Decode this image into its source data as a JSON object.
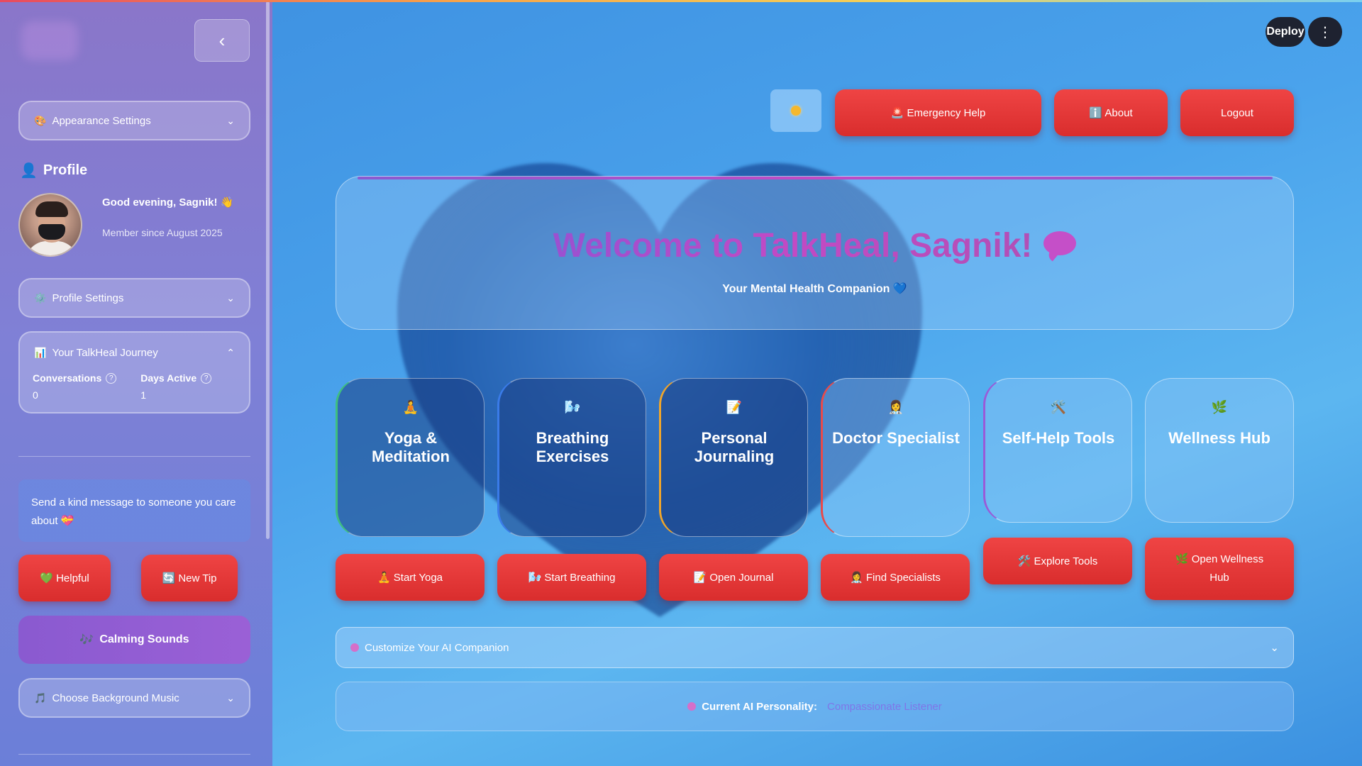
{
  "header": {
    "deploy_label": "Deploy",
    "menu_icon": "kebab-menu-icon"
  },
  "sidebar": {
    "collapse_icon": "chevron-left-icon",
    "appearance": {
      "label": "Appearance Settings",
      "icon": "palette-icon"
    },
    "profile": {
      "title": "Profile",
      "greeting": "Good evening, Sagnik! 👋",
      "member_since": "Member since August 2025"
    },
    "profile_settings": {
      "label": "Profile Settings",
      "icon": "gear-icon"
    },
    "journey": {
      "label": "Your TalkHeal Journey",
      "icon": "chart-icon",
      "metrics": [
        {
          "label": "Conversations",
          "value": "0"
        },
        {
          "label": "Days Active",
          "value": "1"
        }
      ]
    },
    "kind_message": "Send a kind message to someone you care about 💝",
    "buttons": {
      "helpful": "💚 Helpful",
      "new_tip": "🔄 New Tip",
      "calming": "Calming Sounds"
    },
    "music": {
      "label": "Choose Background Music",
      "icon": "music-note-icon"
    }
  },
  "topbar": {
    "theme_icon": "sun-icon",
    "emergency": "🚨 Emergency Help",
    "about": "ℹ️ About",
    "logout": "Logout"
  },
  "hero": {
    "title": "Welcome to TalkHeal, Sagnik!",
    "subtitle": "Your Mental Health Companion 💙"
  },
  "cards": [
    {
      "icon": "🧘",
      "title": "Yoga & Meditation",
      "button": "🧘 Start Yoga"
    },
    {
      "icon": "🌬️",
      "title": "Breathing Exercises",
      "button": "🌬️ Start Breathing"
    },
    {
      "icon": "📝",
      "title": "Personal Journaling",
      "button": "📝 Open Journal"
    },
    {
      "icon": "👩‍⚕️",
      "title": "Doctor Specialist",
      "button": "👩‍⚕️ Find Specialists"
    },
    {
      "icon": "🛠️",
      "title": "Self-Help Tools",
      "button": "🛠️ Explore Tools"
    },
    {
      "icon": "🌿",
      "title": "Wellness Hub",
      "button": "🌿 Open Wellness Hub"
    }
  ],
  "customize": {
    "label": "Customize Your AI Companion"
  },
  "personality": {
    "label": "Current AI Personality:",
    "value": "Compassionate Listener"
  },
  "colors": {
    "accent_red": "#e03a3a",
    "sidebar_purple": "#8a76c9",
    "title_gradient_start": "#9b50d0",
    "title_gradient_end": "#c24ac4"
  }
}
